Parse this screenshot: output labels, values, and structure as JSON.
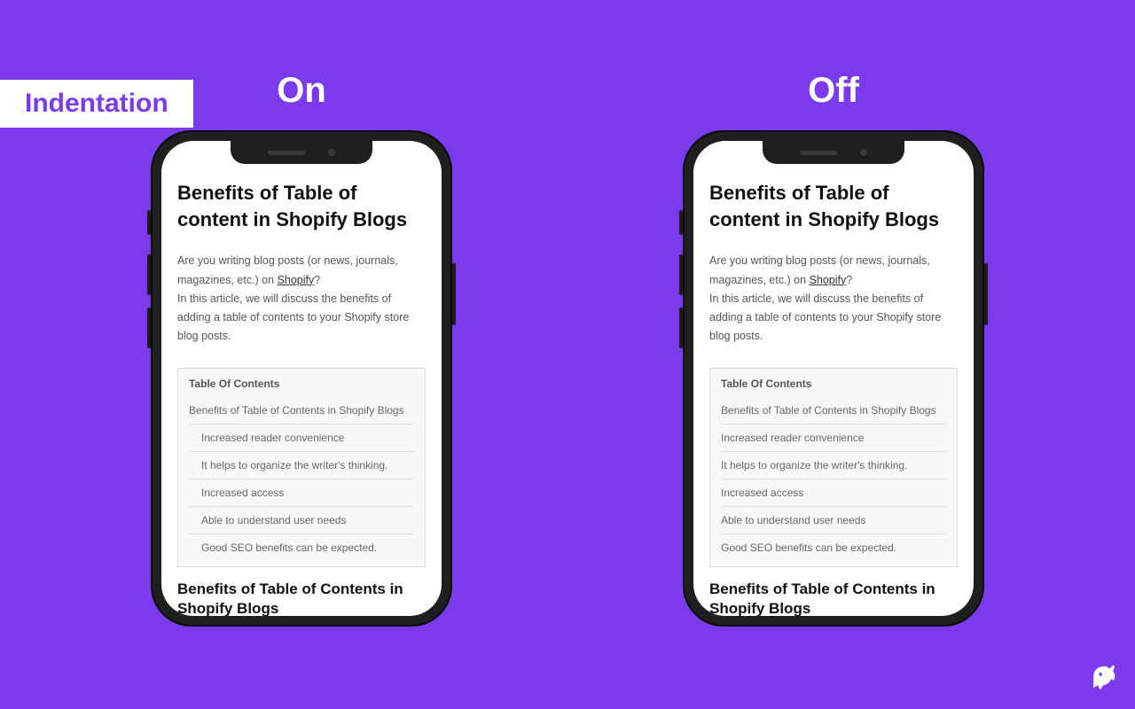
{
  "badge": "Indentation",
  "labels": {
    "on": "On",
    "off": "Off"
  },
  "article": {
    "title": "Benefits of Table of content in Shopify Blogs",
    "intro_pre": "Are you writing blog posts (or news, journals, magazines, etc.) on ",
    "intro_link": "Shopify",
    "intro_post": "?",
    "intro_line2": "In this article, we will discuss the benefits of adding a table of contents to your Shopify store blog posts.",
    "section": "Benefits of Table of Contents in Shopify Blogs"
  },
  "toc": {
    "title": "Table Of Contents",
    "items": [
      {
        "label": "Benefits of Table of Contents in Shopify Blogs",
        "level": 0
      },
      {
        "label": "Increased reader convenience",
        "level": 1
      },
      {
        "label": "It helps to organize the writer's thinking.",
        "level": 1
      },
      {
        "label": "Increased access",
        "level": 1
      },
      {
        "label": "Able to understand user needs",
        "level": 1
      },
      {
        "label": "Good SEO benefits can be expected.",
        "level": 1
      }
    ]
  }
}
